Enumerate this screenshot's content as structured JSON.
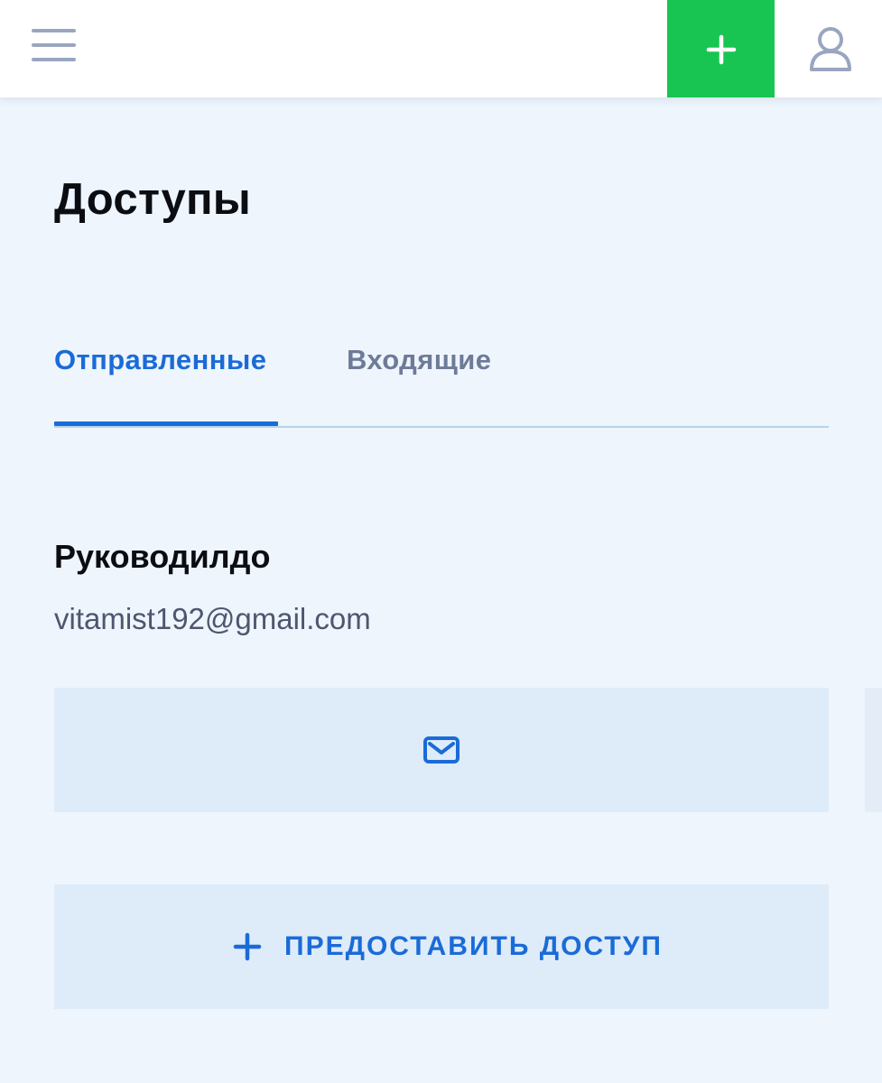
{
  "header": {
    "menu_icon": "hamburger-menu-icon",
    "add_icon": "plus-icon",
    "profile_icon": "user-icon",
    "add_button_color": "#19c552"
  },
  "page": {
    "title": "Доступы"
  },
  "tabs": [
    {
      "label": "Отправленные",
      "active": true
    },
    {
      "label": "Входящие",
      "active": false
    }
  ],
  "entry": {
    "name": "Руководилдо",
    "email": "vitamist192@gmail.com",
    "action_icon": "mail-icon"
  },
  "grant_button": {
    "label": "ПРЕДОСТАВИТЬ ДОСТУП",
    "icon": "plus-icon"
  },
  "colors": {
    "accent": "#1a6bd8",
    "background": "#eef5fc",
    "button_background": "#deebf9",
    "inactive_tab": "#6d7b98"
  }
}
